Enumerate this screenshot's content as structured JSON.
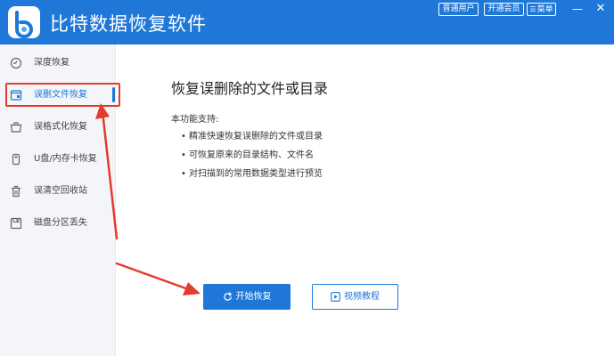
{
  "app": {
    "title": "比特数据恢复软件",
    "logo_icon": "bt-logo-icon"
  },
  "titlebar": {
    "buttons": [
      {
        "label": "普通用户"
      },
      {
        "label": "开通会员"
      },
      {
        "label": "菜单",
        "glyph": "☰"
      }
    ],
    "minimize_glyph": "—",
    "close_glyph": "✕"
  },
  "sidebar": {
    "items": [
      {
        "label": "深度恢复",
        "icon": "deep-scan-icon",
        "active": false
      },
      {
        "label": "误删文件恢复",
        "icon": "deleted-file-icon",
        "active": true
      },
      {
        "label": "误格式化恢复",
        "icon": "format-icon",
        "active": false
      },
      {
        "label": "U盘/内存卡恢复",
        "icon": "usb-icon",
        "active": false
      },
      {
        "label": "误清空回收站",
        "icon": "recycle-bin-icon",
        "active": false
      },
      {
        "label": "磁盘分区丢失",
        "icon": "disk-icon",
        "active": false
      }
    ]
  },
  "main": {
    "title": "恢复误删除的文件或目录",
    "support_heading": "本功能支持:",
    "features": [
      "精准快速恢复误删除的文件或目录",
      "可恢复原来的目录结构、文件名",
      "对扫描到的常用数据类型进行预览"
    ],
    "bullet": "•",
    "start_button": "开始恢复",
    "video_button": "视频教程"
  },
  "colors": {
    "accent": "#1f78d8",
    "annotation": "#e33b2e",
    "sidebar_bg": "#f3f5f8"
  }
}
